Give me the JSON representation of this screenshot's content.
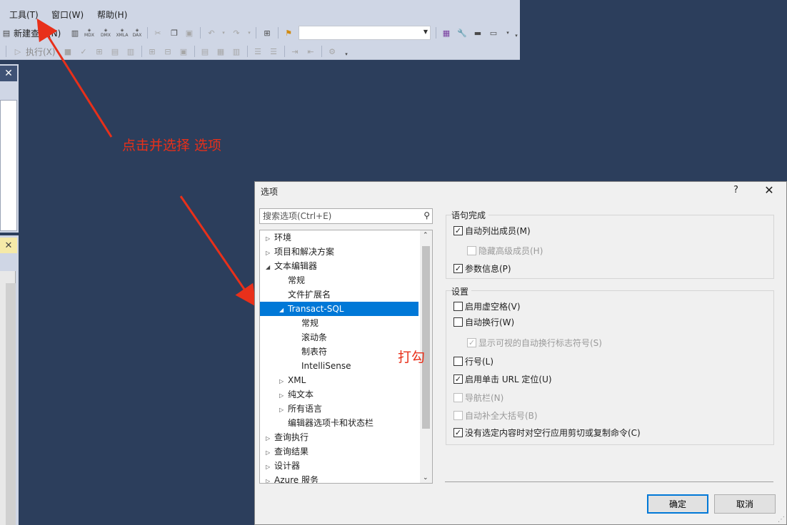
{
  "menubar": {
    "items": [
      {
        "label": "工具(T)"
      },
      {
        "label": "窗口(W)"
      },
      {
        "label": "帮助(H)"
      }
    ]
  },
  "toolbar1": {
    "new_query_label": "新建查询(N)",
    "buttons": [
      "new-query-icon",
      "mdx-icon",
      "dmx-icon",
      "xmla-icon",
      "dax-icon",
      "cut-icon",
      "copy-icon",
      "paste-icon",
      "undo-icon",
      "redo-icon",
      "activity-icon",
      "object-explorer-icon"
    ],
    "icon_labels": {
      "mdx": "MDX",
      "dmx": "DMX",
      "xmla": "XMLA",
      "dax": "DAX"
    },
    "combo_value": ""
  },
  "toolbar2": {
    "execute_label": "执行(X)"
  },
  "annotations": {
    "click_select": "点击并选择  选项",
    "check": "打勾"
  },
  "dialog": {
    "title": "选项",
    "help": "?",
    "search_placeholder": "搜索选项(Ctrl+E)",
    "tree": [
      {
        "label": "环境",
        "level": 0,
        "twisty": "collapsed"
      },
      {
        "label": "项目和解决方案",
        "level": 0,
        "twisty": "collapsed"
      },
      {
        "label": "文本编辑器",
        "level": 0,
        "twisty": "expanded"
      },
      {
        "label": "常规",
        "level": 1,
        "twisty": "none"
      },
      {
        "label": "文件扩展名",
        "level": 1,
        "twisty": "none"
      },
      {
        "label": "Transact-SQL",
        "level": 1,
        "twisty": "expanded",
        "selected": true
      },
      {
        "label": "常规",
        "level": 2,
        "twisty": "none"
      },
      {
        "label": "滚动条",
        "level": 2,
        "twisty": "none"
      },
      {
        "label": "制表符",
        "level": 2,
        "twisty": "none"
      },
      {
        "label": "IntelliSense",
        "level": 2,
        "twisty": "none"
      },
      {
        "label": "XML",
        "level": 1,
        "twisty": "collapsed"
      },
      {
        "label": "纯文本",
        "level": 1,
        "twisty": "collapsed"
      },
      {
        "label": "所有语言",
        "level": 1,
        "twisty": "collapsed"
      },
      {
        "label": "编辑器选项卡和状态栏",
        "level": 1,
        "twisty": "none"
      },
      {
        "label": "查询执行",
        "level": 0,
        "twisty": "collapsed"
      },
      {
        "label": "查询结果",
        "level": 0,
        "twisty": "collapsed"
      },
      {
        "label": "设计器",
        "level": 0,
        "twisty": "collapsed"
      },
      {
        "label": "Azure 服务",
        "level": 0,
        "twisty": "collapsed"
      }
    ],
    "statement_completion": {
      "title": "语句完成",
      "options": [
        {
          "label": "自动列出成员(M)",
          "checked": true,
          "enabled": true
        },
        {
          "label": "隐藏高级成员(H)",
          "checked": false,
          "enabled": false
        },
        {
          "label": "参数信息(P)",
          "checked": true,
          "enabled": true
        }
      ]
    },
    "settings": {
      "title": "设置",
      "options": [
        {
          "label": "启用虚空格(V)",
          "checked": false,
          "enabled": true
        },
        {
          "label": "自动换行(W)",
          "checked": false,
          "enabled": true
        },
        {
          "label": "显示可视的自动换行标志符号(S)",
          "checked": true,
          "enabled": false
        },
        {
          "label": "行号(L)",
          "checked": false,
          "enabled": true
        },
        {
          "label": "启用单击 URL 定位(U)",
          "checked": true,
          "enabled": true
        },
        {
          "label": "导航栏(N)",
          "checked": false,
          "enabled": false
        },
        {
          "label": "自动补全大括号(B)",
          "checked": false,
          "enabled": false
        },
        {
          "label": "没有选定内容时对空行应用剪切或复制命令(C)",
          "checked": true,
          "enabled": true
        }
      ]
    },
    "ok_label": "确定",
    "cancel_label": "取消"
  },
  "colors": {
    "accent": "#0078d7",
    "annotation": "#e8301a",
    "background": "#2c3e5c",
    "chrome": "#cfd6e5"
  }
}
